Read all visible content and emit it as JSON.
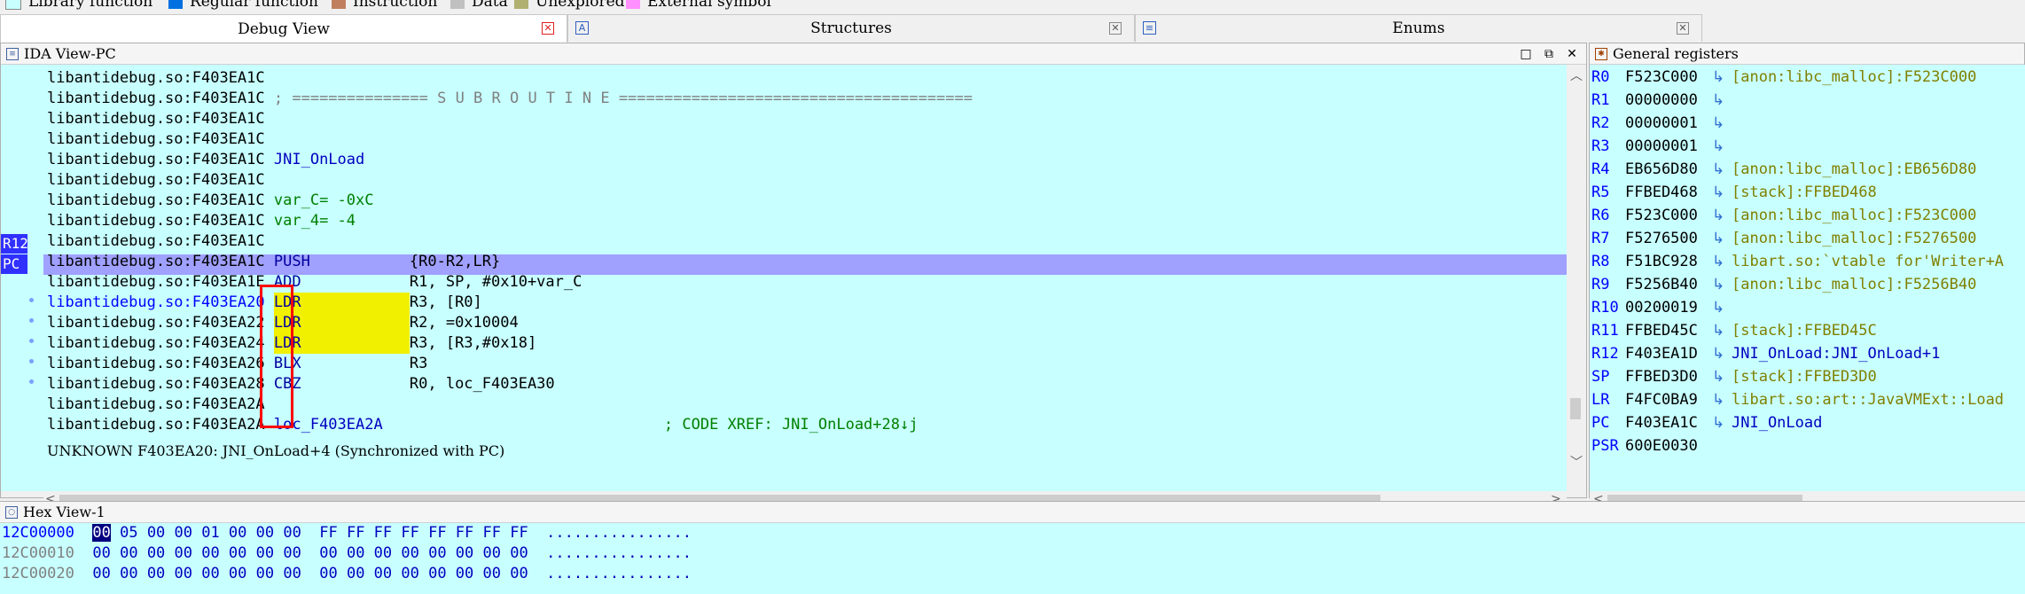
{
  "legend": [
    {
      "label": "Library function",
      "color": "#c8ffff"
    },
    {
      "label": "Regular function",
      "color": "#0070e0"
    },
    {
      "label": "Instruction",
      "color": "#c08060"
    },
    {
      "label": "Data",
      "color": "#c0c0c0"
    },
    {
      "label": "Unexplored",
      "color": "#b0b070"
    },
    {
      "label": "External symbol",
      "color": "#ff90ff"
    }
  ],
  "tabs": {
    "debug_view": "Debug View",
    "structures": "Structures",
    "enums": "Enums"
  },
  "ida_view": {
    "title": "IDA View-PC",
    "gutter_tags": [
      "R12",
      "PC"
    ],
    "lines": [
      {
        "addr": "libantidebug.so:F403EA1C",
        "text": ""
      },
      {
        "addr": "libantidebug.so:F403EA1C",
        "text": "; =============== S U B R O U T I N E ======================================="
      },
      {
        "addr": "libantidebug.so:F403EA1C",
        "text": ""
      },
      {
        "addr": "libantidebug.so:F403EA1C",
        "text": ""
      },
      {
        "addr": "libantidebug.so:F403EA1C",
        "text": "JNI_OnLoad"
      },
      {
        "addr": "libantidebug.so:F403EA1C",
        "text": ""
      },
      {
        "addr": "libantidebug.so:F403EA1C",
        "text": "var_C= -0xC"
      },
      {
        "addr": "libantidebug.so:F403EA1C",
        "text": "var_4= -4"
      },
      {
        "addr": "libantidebug.so:F403EA1C",
        "text": ""
      },
      {
        "addr": "libantidebug.so:F403EA1C",
        "mnem": "PUSH",
        "ops": "{R0-R2,LR}"
      },
      {
        "addr": "libantidebug.so:F403EA1E",
        "mnem": "ADD",
        "ops": "R1, SP, #0x10+var_C"
      },
      {
        "addr": "libantidebug.so:F403EA20",
        "mnem": "LDR",
        "ops": "R3, [R0]"
      },
      {
        "addr": "libantidebug.so:F403EA22",
        "mnem": "LDR",
        "ops": "R2, =0x10004"
      },
      {
        "addr": "libantidebug.so:F403EA24",
        "mnem": "LDR",
        "ops": "R3, [R3,#0x18]"
      },
      {
        "addr": "libantidebug.so:F403EA26",
        "mnem": "BLX",
        "ops": "R3"
      },
      {
        "addr": "libantidebug.so:F403EA28",
        "mnem": "CBZ",
        "ops": "R0, loc_F403EA30"
      },
      {
        "addr": "libantidebug.so:F403EA2A",
        "text": ""
      },
      {
        "addr": "libantidebug.so:F403EA2A",
        "label": "loc_F403EA2A",
        "comment": "; CODE XREF: JNI_OnLoad+28↓j"
      }
    ],
    "status": "UNKNOWN F403EA20: JNI_OnLoad+4 (Synchronized with PC)"
  },
  "registers": {
    "title": "General registers",
    "rows": [
      {
        "name": "R0",
        "value": "F523C000",
        "arrow": true,
        "target": "[anon:libc_malloc]:F523C000"
      },
      {
        "name": "R1",
        "value": "00000000",
        "arrow": true,
        "target": ""
      },
      {
        "name": "R2",
        "value": "00000001",
        "arrow": true,
        "target": ""
      },
      {
        "name": "R3",
        "value": "00000001",
        "arrow": true,
        "target": ""
      },
      {
        "name": "R4",
        "value": "EB656D80",
        "arrow": true,
        "target": "[anon:libc_malloc]:EB656D80"
      },
      {
        "name": "R5",
        "value": "FFBED468",
        "arrow": true,
        "target": "[stack]:FFBED468"
      },
      {
        "name": "R6",
        "value": "F523C000",
        "arrow": true,
        "target": "[anon:libc_malloc]:F523C000"
      },
      {
        "name": "R7",
        "value": "F5276500",
        "arrow": true,
        "target": "[anon:libc_malloc]:F5276500"
      },
      {
        "name": "R8",
        "value": "F51BC928",
        "arrow": true,
        "target": "libart.so:`vtable for'Writer+A"
      },
      {
        "name": "R9",
        "value": "F5256B40",
        "arrow": true,
        "target": "[anon:libc_malloc]:F5256B40"
      },
      {
        "name": "R10",
        "value": "00200019",
        "arrow": true,
        "target": ""
      },
      {
        "name": "R11",
        "value": "FFBED45C",
        "arrow": true,
        "target": "[stack]:FFBED45C"
      },
      {
        "name": "R12",
        "value": "F403EA1D",
        "arrow": true,
        "target": "JNI_OnLoad:JNI_OnLoad+1"
      },
      {
        "name": "SP",
        "value": "FFBED3D0",
        "arrow": true,
        "target": "[stack]:FFBED3D0"
      },
      {
        "name": "LR",
        "value": "F4FC0BA9",
        "arrow": true,
        "target": "libart.so:art::JavaVMExt::Load"
      },
      {
        "name": "PC",
        "value": "F403EA1C",
        "arrow": true,
        "target": "JNI_OnLoad"
      },
      {
        "name": "PSR",
        "value": "600E0030",
        "arrow": false,
        "target": ""
      }
    ]
  },
  "hex_view": {
    "title": "Hex View-1",
    "rows": [
      {
        "addr": "12C00000",
        "first": "00",
        "bytes": "05 00 00 01 00 00 00  FF FF FF FF FF FF FF FF",
        "ascii": "................"
      },
      {
        "addr": "12C00010",
        "first": "00",
        "bytes": "00 00 00 00 00 00 00  00 00 00 00 00 00 00 00",
        "ascii": "................"
      },
      {
        "addr": "12C00020",
        "first": "00",
        "bytes": "00 00 00 00 00 00 00  00 00 00 00 00 00 00 00",
        "ascii": "................"
      }
    ]
  }
}
